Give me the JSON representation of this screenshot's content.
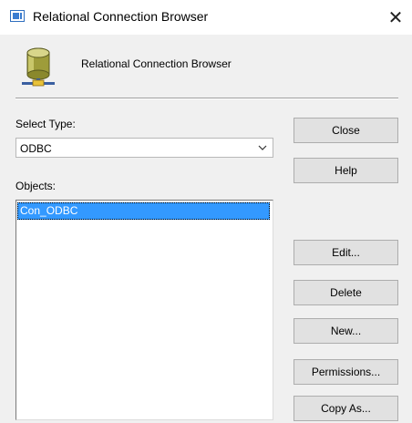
{
  "window": {
    "title": "Relational Connection Browser",
    "close_symbol": "✕"
  },
  "header": {
    "text": "Relational Connection Browser",
    "icon": "database-connection-icon"
  },
  "select_type": {
    "label": "Select Type:",
    "value": "ODBC"
  },
  "objects": {
    "label": "Objects:",
    "items": [
      "Con_ODBC"
    ],
    "selected_index": 0
  },
  "buttons": {
    "close": "Close",
    "help": "Help",
    "edit": "Edit...",
    "delete": "Delete",
    "new": "New...",
    "permissions": "Permissions...",
    "copy_as": "Copy As..."
  },
  "colors": {
    "selection": "#3399ff",
    "window_bg": "#f0f0f0",
    "button_bg": "#e1e1e1"
  }
}
